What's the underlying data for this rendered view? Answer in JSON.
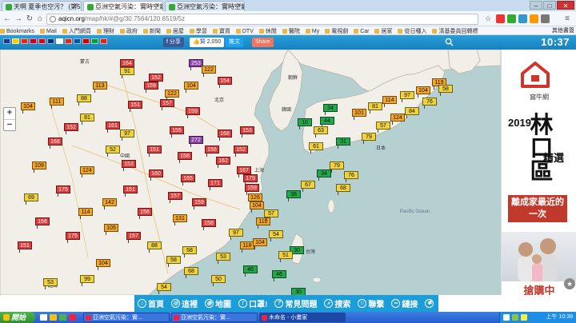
{
  "browser": {
    "tabs": [
      {
        "title": "天啊 夏季也空污？ (第523"
      },
      {
        "title": "亞洲空氣污染：實時空氣"
      },
      {
        "title": "亞洲空氣污染：實時空氣"
      }
    ],
    "url_host": "aqicn.org",
    "url_path": "/map/hk/#@g/30.7564/120.6519/5z",
    "bookmarks": [
      "Bookmarks",
      "Mail",
      "入門網頁",
      "理財",
      "政府",
      "新聞",
      "居屋",
      "學習",
      "寶貨",
      "DTV",
      "休閒",
      "醫院",
      "My",
      "電視劇",
      "Car",
      "居家",
      "從日種入",
      "清基委員回轉標"
    ],
    "other_bookmarks": "其他書簽"
  },
  "site": {
    "fb_share": "分享",
    "like_label": "贊",
    "like_count": "2,050",
    "tweet": "推文",
    "share": "Share",
    "time": "10:37",
    "flag_colors": [
      "#1a3a8f",
      "#ffcc00",
      "#de2910",
      "#bc002d",
      "#c60b1e",
      "#003478",
      "#fff",
      "#d52b1e",
      "#0055a4",
      "#cc0000",
      "#009c3b",
      "#da251d"
    ]
  },
  "map": {
    "places": [
      "中國",
      "日本",
      "北京",
      "上海",
      "台灣",
      "越南",
      "朝鮮",
      "韓國",
      "蒙古",
      "Pacific Ocean"
    ],
    "stations": [
      {
        "v": "164",
        "c": "#e03b3b"
      },
      {
        "v": "253",
        "c": "#8b3fa8"
      },
      {
        "v": "91",
        "c": "#f0d23a"
      },
      {
        "v": "152",
        "c": "#e03b3b"
      },
      {
        "v": "122",
        "c": "#f5a623"
      },
      {
        "v": "154",
        "c": "#e03b3b"
      },
      {
        "v": "104",
        "c": "#f5a623"
      },
      {
        "v": "111",
        "c": "#f5a623"
      },
      {
        "v": "151",
        "c": "#e03b3b"
      },
      {
        "v": "157",
        "c": "#e03b3b"
      },
      {
        "v": "159",
        "c": "#e03b3b"
      },
      {
        "v": "81",
        "c": "#f0d23a"
      },
      {
        "v": "152",
        "c": "#e03b3b"
      },
      {
        "v": "161",
        "c": "#e03b3b"
      },
      {
        "v": "97",
        "c": "#f0d23a"
      },
      {
        "v": "272",
        "c": "#8b3fa8"
      },
      {
        "v": "168",
        "c": "#e03b3b"
      },
      {
        "v": "155",
        "c": "#e03b3b"
      },
      {
        "v": "156",
        "c": "#e03b3b"
      },
      {
        "v": "151",
        "c": "#e03b3b"
      },
      {
        "v": "158",
        "c": "#e03b3b"
      },
      {
        "v": "162",
        "c": "#e03b3b"
      },
      {
        "v": "153",
        "c": "#e03b3b"
      },
      {
        "v": "124",
        "c": "#f5a623"
      },
      {
        "v": "160",
        "c": "#e03b3b"
      },
      {
        "v": "165",
        "c": "#e03b3b"
      },
      {
        "v": "171",
        "c": "#e03b3b"
      },
      {
        "v": "151",
        "c": "#e03b3b"
      },
      {
        "v": "157",
        "c": "#e03b3b"
      },
      {
        "v": "159",
        "c": "#e03b3b"
      },
      {
        "v": "142",
        "c": "#f5a623"
      },
      {
        "v": "114",
        "c": "#f5a623"
      },
      {
        "v": "156",
        "c": "#e03b3b"
      },
      {
        "v": "131",
        "c": "#f5a623"
      },
      {
        "v": "158",
        "c": "#e03b3b"
      },
      {
        "v": "105",
        "c": "#f5a623"
      },
      {
        "v": "175",
        "c": "#e03b3b"
      },
      {
        "v": "157",
        "c": "#e03b3b"
      },
      {
        "v": "88",
        "c": "#f0d23a"
      },
      {
        "v": "58",
        "c": "#f0d23a"
      },
      {
        "v": "58",
        "c": "#f0d23a"
      },
      {
        "v": "53",
        "c": "#f0d23a"
      },
      {
        "v": "68",
        "c": "#f0d23a"
      },
      {
        "v": "50",
        "c": "#f0d23a"
      },
      {
        "v": "104",
        "c": "#f5a623"
      },
      {
        "v": "99",
        "c": "#f0d23a"
      },
      {
        "v": "53",
        "c": "#f0d23a"
      },
      {
        "v": "54",
        "c": "#f0d23a"
      },
      {
        "v": "34",
        "c": "#22a84a"
      },
      {
        "v": "44",
        "c": "#22a84a"
      },
      {
        "v": "10",
        "c": "#22a84a"
      },
      {
        "v": "63",
        "c": "#f0d23a"
      },
      {
        "v": "31",
        "c": "#22a84a"
      },
      {
        "v": "61",
        "c": "#f0d23a"
      },
      {
        "v": "101",
        "c": "#f5a623"
      },
      {
        "v": "81",
        "c": "#f0d23a"
      },
      {
        "v": "114",
        "c": "#f5a623"
      },
      {
        "v": "97",
        "c": "#f0d23a"
      },
      {
        "v": "104",
        "c": "#f5a623"
      },
      {
        "v": "119",
        "c": "#f5a623"
      },
      {
        "v": "79",
        "c": "#f0d23a"
      },
      {
        "v": "76",
        "c": "#f0d23a"
      },
      {
        "v": "34",
        "c": "#22a84a"
      },
      {
        "v": "67",
        "c": "#f0d23a"
      },
      {
        "v": "38",
        "c": "#22a84a"
      },
      {
        "v": "68",
        "c": "#f0d23a"
      },
      {
        "v": "79",
        "c": "#f0d23a"
      },
      {
        "v": "57",
        "c": "#f0d23a"
      },
      {
        "v": "124",
        "c": "#f5a623"
      },
      {
        "v": "84",
        "c": "#f0d23a"
      },
      {
        "v": "76",
        "c": "#f0d23a"
      },
      {
        "v": "58",
        "c": "#f0d23a"
      },
      {
        "v": "30",
        "c": "#22a84a"
      },
      {
        "v": "46",
        "c": "#22a84a"
      },
      {
        "v": "118",
        "c": "#f5a623"
      },
      {
        "v": "110",
        "c": "#f5a623"
      },
      {
        "v": "126",
        "c": "#f5a623"
      },
      {
        "v": "97",
        "c": "#f0d23a"
      },
      {
        "v": "168",
        "c": "#e03b3b"
      },
      {
        "v": "109",
        "c": "#f5a623"
      },
      {
        "v": "69",
        "c": "#f0d23a"
      },
      {
        "v": "156",
        "c": "#e03b3b"
      },
      {
        "v": "151",
        "c": "#e03b3b"
      },
      {
        "v": "175",
        "c": "#e03b3b"
      },
      {
        "v": "159",
        "c": "#e03b3b"
      },
      {
        "v": "113",
        "c": "#f5a623"
      },
      {
        "v": "88",
        "c": "#f0d23a"
      },
      {
        "v": "122",
        "c": "#f5a623"
      },
      {
        "v": "104",
        "c": "#f5a623"
      },
      {
        "v": "52",
        "c": "#f0d23a"
      },
      {
        "v": "153",
        "c": "#e03b3b"
      },
      {
        "v": "152",
        "c": "#e03b3b"
      },
      {
        "v": "167",
        "c": "#e03b3b"
      },
      {
        "v": "179",
        "c": "#e03b3b"
      },
      {
        "v": "159",
        "c": "#e03b3b"
      },
      {
        "v": "104",
        "c": "#f5a623"
      },
      {
        "v": "57",
        "c": "#f0d23a"
      },
      {
        "v": "54",
        "c": "#f0d23a"
      },
      {
        "v": "104",
        "c": "#f5a623"
      },
      {
        "v": "51",
        "c": "#f0d23a"
      },
      {
        "v": "46",
        "c": "#22a84a"
      },
      {
        "v": "30",
        "c": "#22a84a"
      }
    ]
  },
  "ad": {
    "brand": "窩牛網",
    "year": "2019",
    "title": "林口區",
    "badge": "精選",
    "slogan": "離成家最近的一次",
    "cta": "搶購中"
  },
  "bottom_nav": [
    "首頁",
    "這裡",
    "地圖",
    "口罩!",
    "常見問題",
    "搜索",
    "聯繫",
    "鏈接"
  ],
  "taskbar": {
    "start": "開始",
    "tasks": [
      "亞洲空氣污染：實...",
      "亞洲空氣污染：實...",
      "木命名 - 小畫家"
    ],
    "clock": "上午 10:39"
  }
}
